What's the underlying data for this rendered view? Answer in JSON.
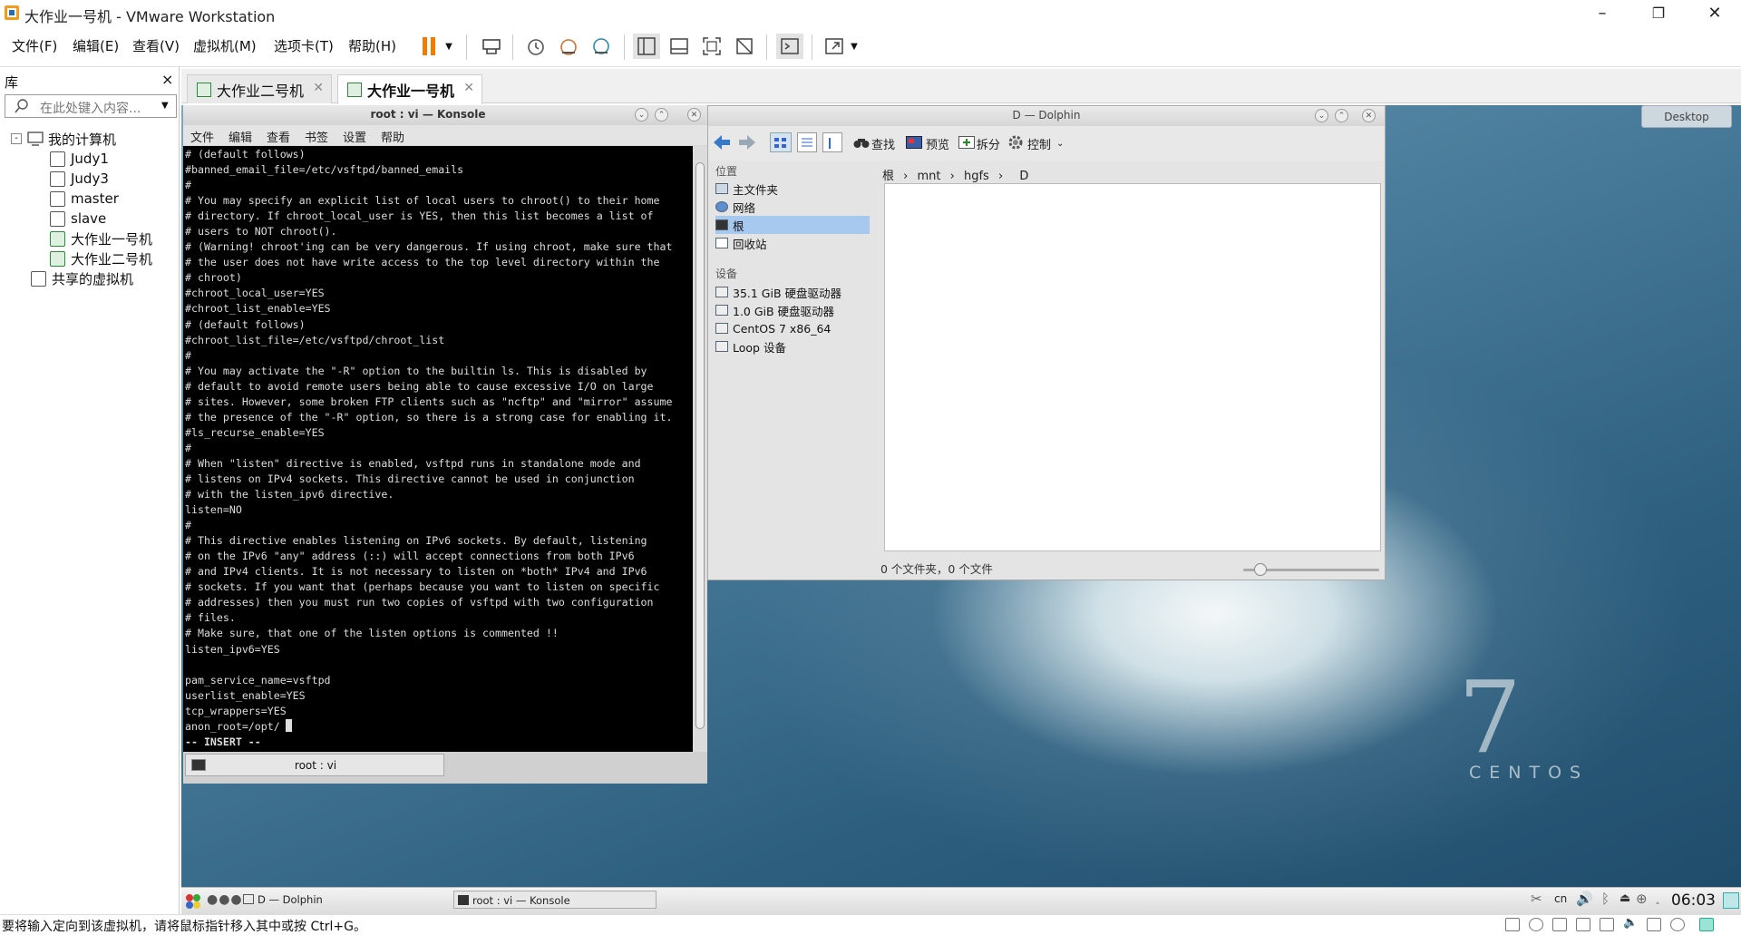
{
  "window": {
    "title": "大作业一号机 - VMware Workstation",
    "min_icon": "minimize-icon",
    "restore_icon": "restore-icon",
    "close_icon": "close-icon"
  },
  "menu": [
    "文件(F)",
    "编辑(E)",
    "查看(V)",
    "虚拟机(M)",
    "选项卡(T)",
    "帮助(H)"
  ],
  "library": {
    "title": "库",
    "close": "×",
    "search_placeholder": "在此处键入内容...",
    "tree": [
      "我的计算机",
      "Judy1",
      "Judy3",
      "master",
      "slave",
      "大作业一号机",
      "大作业二号机",
      "共享的虚拟机"
    ]
  },
  "tabs": [
    {
      "label": "大作业二号机",
      "active": false
    },
    {
      "label": "大作业一号机",
      "active": true
    }
  ],
  "konsole": {
    "title": "root : vi — Konsole",
    "menu": [
      "文件",
      "编辑",
      "查看",
      "书签",
      "设置",
      "帮助"
    ],
    "lines": [
      "# (default follows)",
      "#banned_email_file=/etc/vsftpd/banned_emails",
      "#",
      "# You may specify an explicit list of local users to chroot() to their home",
      "# directory. If chroot_local_user is YES, then this list becomes a list of",
      "# users to NOT chroot().",
      "# (Warning! chroot'ing can be very dangerous. If using chroot, make sure that",
      "# the user does not have write access to the top level directory within the",
      "# chroot)",
      "#chroot_local_user=YES",
      "#chroot_list_enable=YES",
      "# (default follows)",
      "#chroot_list_file=/etc/vsftpd/chroot_list",
      "#",
      "# You may activate the \"-R\" option to the builtin ls. This is disabled by",
      "# default to avoid remote users being able to cause excessive I/O on large",
      "# sites. However, some broken FTP clients such as \"ncftp\" and \"mirror\" assume",
      "# the presence of the \"-R\" option, so there is a strong case for enabling it.",
      "#ls_recurse_enable=YES",
      "#",
      "# When \"listen\" directive is enabled, vsftpd runs in standalone mode and",
      "# listens on IPv4 sockets. This directive cannot be used in conjunction",
      "# with the listen_ipv6 directive.",
      "listen=NO",
      "#",
      "# This directive enables listening on IPv6 sockets. By default, listening",
      "# on the IPv6 \"any\" address (::) will accept connections from both IPv6",
      "# and IPv4 clients. It is not necessary to listen on *both* IPv4 and IPv6",
      "# sockets. If you want that (perhaps because you want to listen on specific",
      "# addresses) then you must run two copies of vsftpd with two configuration",
      "# files.",
      "# Make sure, that one of the listen options is commented !!",
      "listen_ipv6=YES",
      "",
      "pam_service_name=vsftpd",
      "userlist_enable=YES",
      "tcp_wrappers=YES",
      "anon_root=/opt/"
    ],
    "mode_line": "-- INSERT --",
    "tab_label": "root : vi"
  },
  "dolphin": {
    "title": "D — Dolphin",
    "toolbar": {
      "find": "查找",
      "preview": "预览",
      "split": "拆分",
      "control": "控制"
    },
    "places_header": "位置",
    "places": [
      "主文件夹",
      "网络",
      "根",
      "回收站"
    ],
    "places_selected_index": 2,
    "devices_header": "设备",
    "devices": [
      "35.1 GiB 硬盘驱动器",
      "1.0 GiB 硬盘驱动器",
      "CentOS 7 x86_64",
      "Loop 设备"
    ],
    "breadcrumb": [
      "根",
      "mnt",
      "hgfs",
      "D"
    ],
    "status": "0 个文件夹，0 个文件"
  },
  "desktop": {
    "button": "Desktop",
    "logo_number": "7",
    "logo_word": "CENTOS"
  },
  "guest_taskbar": {
    "tasks": [
      "D — Dolphin",
      "root : vi — Konsole"
    ],
    "lang": "cn",
    "clock": "06:03"
  },
  "status_bar": {
    "message": "要将输入定向到该虚拟机，请将鼠标指针移入其中或按 Ctrl+G。"
  }
}
